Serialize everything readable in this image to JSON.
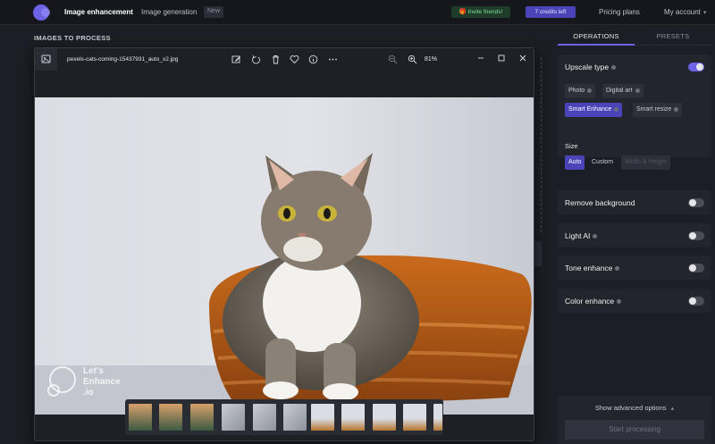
{
  "nav": {
    "enhancement": "Image enhancement",
    "generation": "Image generation",
    "new_badge": "New",
    "invite": "🎁 Invite friends!",
    "credits": "7 credits left",
    "pricing": "Pricing plans",
    "account": "My account"
  },
  "main": {
    "section_title": "IMAGES TO PROCESS"
  },
  "viewer": {
    "file_name": "pexels-cats-coming-15437931_auto_x2.jpg",
    "zoom": "81%",
    "watermark": [
      "Let's",
      "Enhance",
      ".io"
    ]
  },
  "panel": {
    "tabs": [
      "OPERATIONS",
      "PRESETS"
    ],
    "upscale": {
      "title": "Upscale type",
      "enabled": true,
      "options": [
        "Photo",
        "Digital art",
        "Smart Enhance",
        "Smart resize"
      ],
      "selected": "Smart Enhance"
    },
    "size": {
      "title": "Size",
      "options": [
        "Auto",
        "Custom",
        "Width & Height"
      ],
      "selected": "Auto"
    },
    "remove_background": {
      "title": "Remove background",
      "enabled": false
    },
    "light_ai": {
      "title": "Light AI",
      "enabled": false
    },
    "tone": {
      "title": "Tone enhance",
      "enabled": false
    },
    "color": {
      "title": "Color enhance",
      "enabled": false
    },
    "advanced": "Show advanced options",
    "start": "Start processing"
  },
  "colors": {
    "accent": "#6d63e6",
    "background": "#1c1e25",
    "panel": "#23252d"
  }
}
